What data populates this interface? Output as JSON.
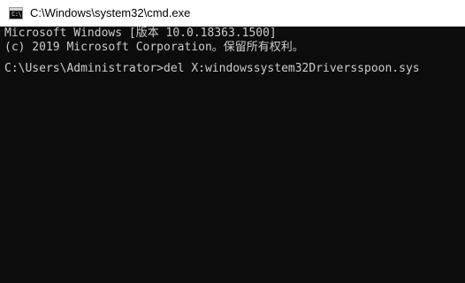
{
  "window": {
    "title": "C:\\Windows\\system32\\cmd.exe",
    "icon": "cmd-console-icon",
    "icon_prompt": "C:\\"
  },
  "console": {
    "lines": [
      "Microsoft Windows [版本 10.0.18363.1500]",
      "(c) 2019 Microsoft Corporation。保留所有权利。"
    ],
    "prompt": "C:\\Users\\Administrator>",
    "command": "del X:windowssystem32Driversspoon.sys"
  },
  "colors": {
    "console_background": "#0c0c0c",
    "console_text": "#cccccc",
    "titlebar_background": "#ffffff"
  }
}
